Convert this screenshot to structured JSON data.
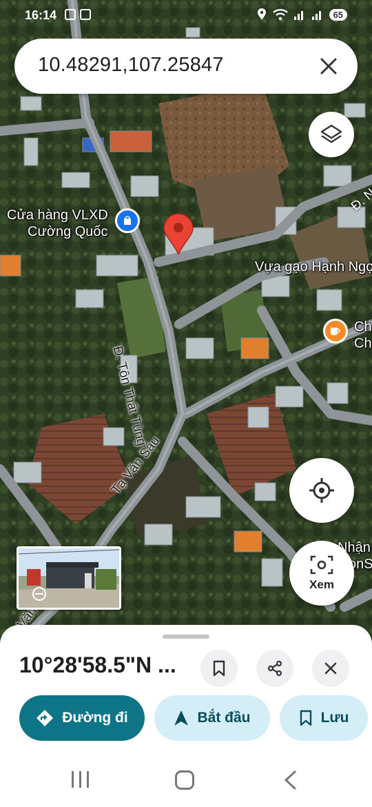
{
  "status_bar": {
    "time": "16:14",
    "battery": "65"
  },
  "search": {
    "value": "10.48291,107.25847"
  },
  "map_labels": {
    "store": [
      "Cửa hàng VLXD",
      "Cường Quốc"
    ],
    "rice_shop": "Vựa gạo Hạnh Ngọ",
    "cafe_partial": [
      "Ch",
      "Ch"
    ],
    "nhan_partial": [
      "Nhận",
      "onS"
    ],
    "road_ton_that_tung": "Đ. Tôn Thất Tùng",
    "road_ta_van_sau": "Tạ Văn Sáu",
    "road_top_right": "Đ. N",
    "road_bottom_left": "Tạ Văn S"
  },
  "controls": {
    "lens_label": "Xem"
  },
  "sheet": {
    "title": "10°28'58.5\"N ...",
    "directions_label": "Đường đi",
    "start_label": "Bắt đầu",
    "save_label": "Lưu"
  },
  "colors": {
    "primary": "#0e7488",
    "secondary_bg": "#d3eef7",
    "pin_red": "#ea4335",
    "poi_blue": "#1a73e8",
    "poi_orange": "#f28b2a"
  }
}
